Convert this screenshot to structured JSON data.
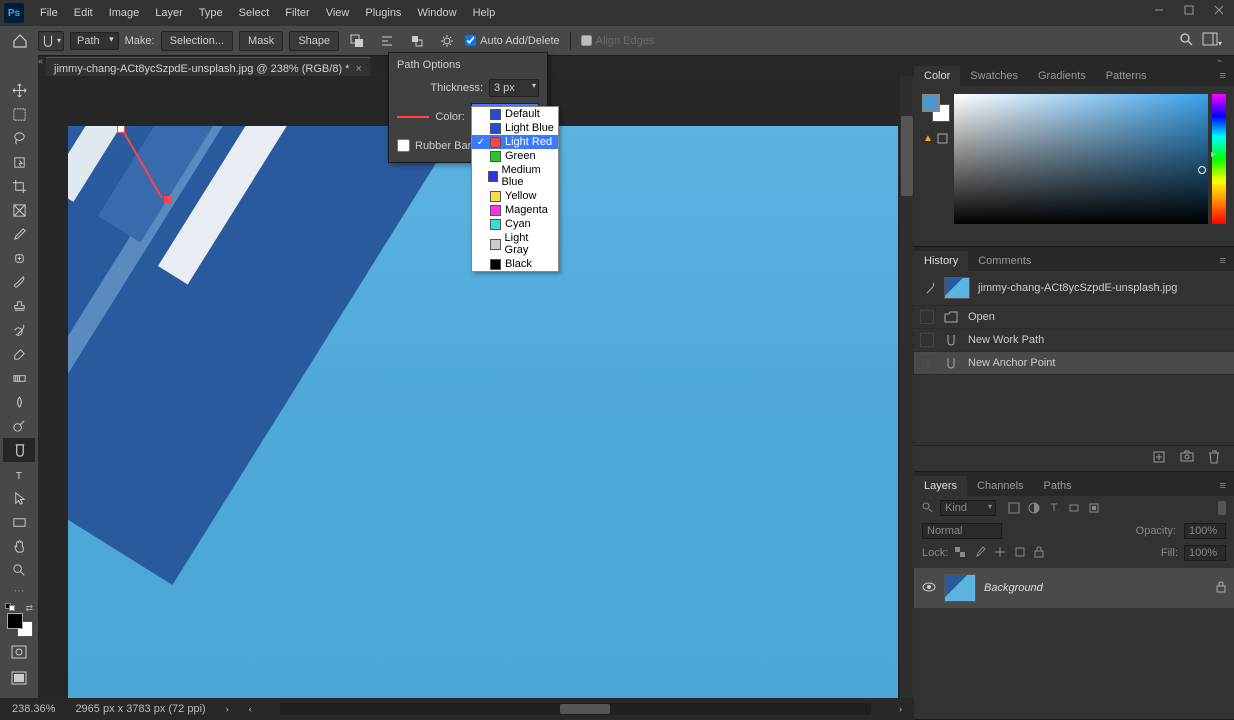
{
  "menu": {
    "items": [
      "File",
      "Edit",
      "Image",
      "Layer",
      "Type",
      "Select",
      "Filter",
      "View",
      "Plugins",
      "Window",
      "Help"
    ]
  },
  "options": {
    "mode": "Path",
    "make_label": "Make:",
    "selection": "Selection...",
    "mask": "Mask",
    "shape": "Shape",
    "auto_add_delete": "Auto Add/Delete",
    "align_edges": "Align Edges"
  },
  "tab": {
    "title": "jimmy-chang-ACt8ycSzpdE-unsplash.jpg @ 238% (RGB/8) *"
  },
  "path_options": {
    "title": "Path Options",
    "thickness_label": "Thickness:",
    "thickness_value": "3 px",
    "color_label": "Color:",
    "color_value": "Light Red",
    "rubber_band": "Rubber Band"
  },
  "color_dropdown": {
    "items": [
      {
        "label": "Default",
        "color": "#2a4ad0",
        "checked": false
      },
      {
        "label": "Light Blue",
        "color": "#2a4ad0",
        "checked": false
      },
      {
        "label": "Light Red",
        "color": "#f44",
        "checked": true
      },
      {
        "label": "Green",
        "color": "#2c2",
        "checked": false
      },
      {
        "label": "Medium Blue",
        "color": "#33d",
        "checked": false
      },
      {
        "label": "Yellow",
        "color": "#fd4",
        "checked": false
      },
      {
        "label": "Magenta",
        "color": "#f3d",
        "checked": false
      },
      {
        "label": "Cyan",
        "color": "#3dd",
        "checked": false
      },
      {
        "label": "Light Gray",
        "color": "#ccc",
        "checked": false
      },
      {
        "label": "Black",
        "color": "#000",
        "checked": false
      }
    ]
  },
  "color_panel": {
    "tabs": [
      "Color",
      "Swatches",
      "Gradients",
      "Patterns"
    ]
  },
  "history_panel": {
    "tabs": [
      "History",
      "Comments"
    ],
    "doc_name": "jimmy-chang-ACt8ycSzpdE-unsplash.jpg",
    "items": [
      "Open",
      "New Work Path",
      "New Anchor Point"
    ]
  },
  "layers_panel": {
    "tabs": [
      "Layers",
      "Channels",
      "Paths"
    ],
    "kind": "Kind",
    "blend_mode": "Normal",
    "opacity_label": "Opacity:",
    "opacity_value": "100%",
    "lock_label": "Lock:",
    "fill_label": "Fill:",
    "fill_value": "100%",
    "layer_name": "Background"
  },
  "status": {
    "zoom": "238.36%",
    "doc_info": "2965 px x 3783 px (72 ppi)"
  }
}
